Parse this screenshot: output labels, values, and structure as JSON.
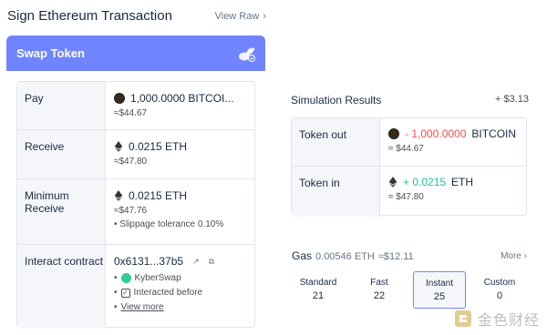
{
  "header": {
    "title": "Sign Ethereum Transaction",
    "view_raw": "View Raw"
  },
  "swap": {
    "title": "Swap Token"
  },
  "details": {
    "pay": {
      "label": "Pay",
      "amount": "1,000.0000 BITCOI...",
      "usd": "≈$44.67"
    },
    "receive": {
      "label": "Receive",
      "amount": "0.0215 ETH",
      "usd": "≈$47.80"
    },
    "minimum": {
      "label": "Minimum Receive",
      "amount": "0.0215 ETH",
      "usd": "≈$47.76",
      "slippage": "Slippage tolerance 0.10%"
    },
    "interact": {
      "label": "Interact contract",
      "address": "0x6131...37b5",
      "protocol": "KyberSwap",
      "interacted": "Interacted before",
      "view_more": "View more"
    }
  },
  "simulation": {
    "title": "Simulation Results",
    "delta": "+ $3.13",
    "token_out": {
      "label": "Token out",
      "amount": "- 1,000.0000",
      "symbol": "BITCOIN",
      "usd": "≈ $44.67"
    },
    "token_in": {
      "label": "Token in",
      "amount": "+ 0.0215",
      "symbol": "ETH",
      "usd": "≈ $47.80"
    }
  },
  "gas": {
    "label": "Gas",
    "amount": "0.00546 ETH",
    "usd": "≈$12.11",
    "more": "More",
    "speeds": [
      {
        "name": "Standard",
        "value": "21"
      },
      {
        "name": "Fast",
        "value": "22"
      },
      {
        "name": "Instant",
        "value": "25"
      },
      {
        "name": "Custom",
        "value": "0"
      }
    ]
  },
  "colors": {
    "accent": "#7084ff",
    "negative": "#ec5151",
    "positive": "#27c193"
  },
  "watermark": {
    "text": "金色财经"
  }
}
